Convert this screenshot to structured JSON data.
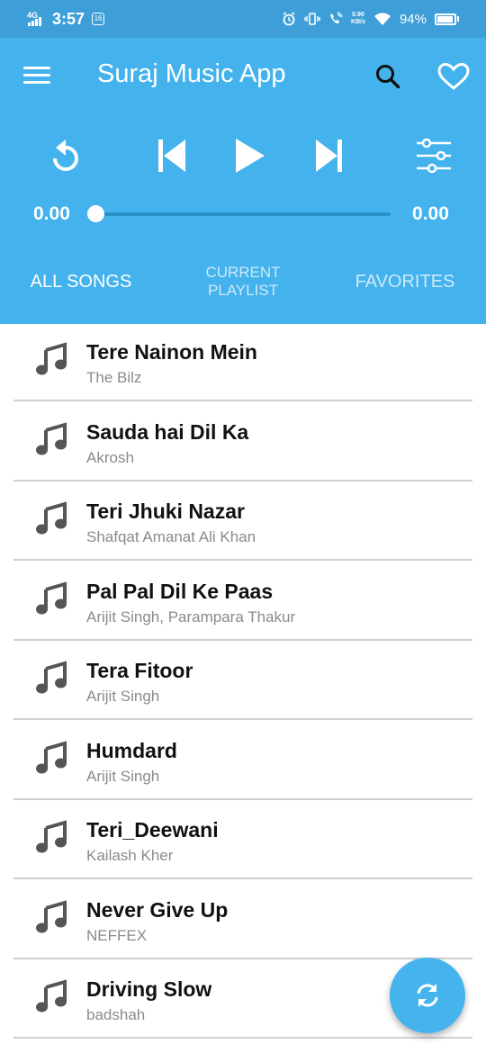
{
  "status_bar": {
    "network": "4G",
    "time": "3:57",
    "speed_value": "0.90",
    "speed_unit": "KB/s",
    "battery": "94%",
    "battery_level": 0.94
  },
  "header": {
    "title": "Suraj Music App",
    "icons": [
      "menu-icon",
      "search-icon",
      "heart-icon"
    ]
  },
  "player": {
    "controls": [
      "replay-icon",
      "skip-previous-icon",
      "play-icon",
      "skip-next-icon",
      "equalizer-icon"
    ],
    "current_time": "0.00",
    "total_time": "0.00",
    "progress": 0
  },
  "tabs": {
    "all_songs": "ALL SONGS",
    "current_playlist_line1": "CURRENT",
    "current_playlist_line2": "PLAYLIST",
    "favorites": "FAVORITES",
    "active": "all_songs"
  },
  "songs": [
    {
      "title": "Tere Nainon Mein",
      "artist": "The Bilz"
    },
    {
      "title": "Sauda hai Dil Ka",
      "artist": "Akrosh"
    },
    {
      "title": "Teri Jhuki Nazar",
      "artist": "Shafqat Amanat Ali Khan"
    },
    {
      "title": "Pal Pal Dil Ke Paas",
      "artist": "Arijit Singh, Parampara Thakur"
    },
    {
      "title": "Tera Fitoor",
      "artist": "Arijit Singh"
    },
    {
      "title": "Humdard",
      "artist": "Arijit Singh"
    },
    {
      "title": "Teri_Deewani",
      "artist": "Kailash Kher"
    },
    {
      "title": "Never Give Up",
      "artist": "NEFFEX"
    },
    {
      "title": "Driving Slow",
      "artist": "badshah"
    }
  ],
  "fab": {
    "icon": "sync-icon"
  },
  "colors": {
    "status_bar": "#3e9fd8",
    "header": "#44b2ec",
    "fab": "#46b4ec",
    "note_icon": "#555555"
  }
}
